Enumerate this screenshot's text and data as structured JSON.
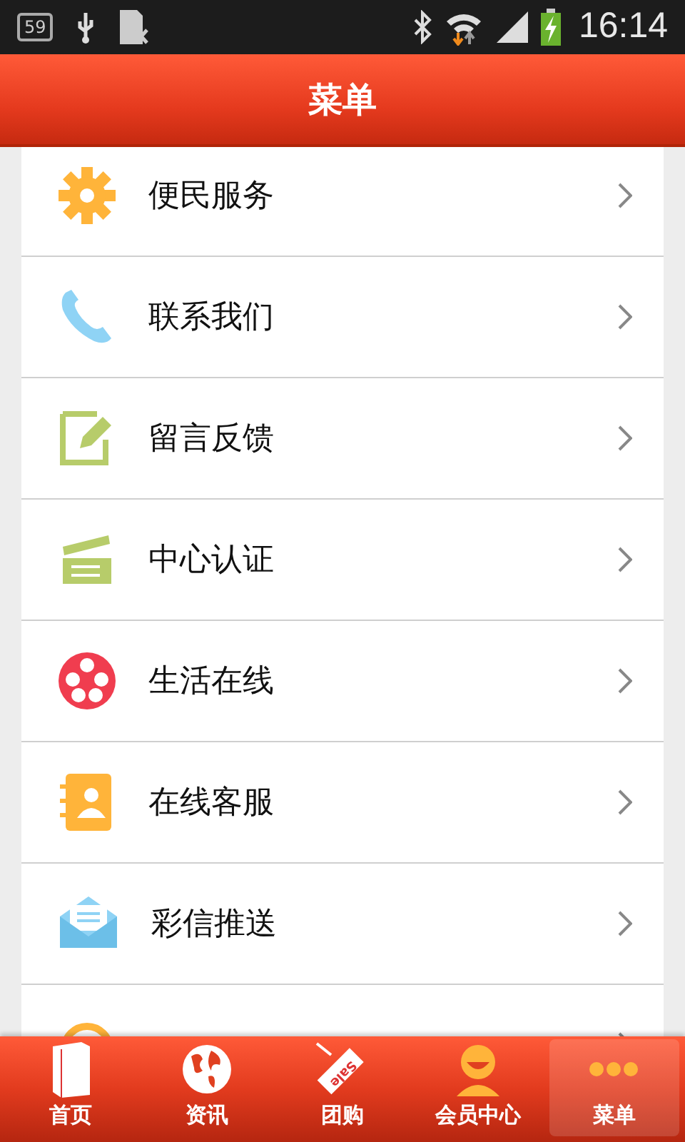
{
  "status_bar": {
    "notification_count": "59",
    "time": "16:14"
  },
  "header": {
    "title": "菜单"
  },
  "menu_items": [
    {
      "kind": "full",
      "label": "便民服务"
    },
    {
      "kind": "full",
      "label": "联系我们"
    },
    {
      "kind": "full",
      "label": "留言反馈"
    },
    {
      "kind": "full",
      "label": "中心认证"
    },
    {
      "kind": "full",
      "label": "生活在线"
    },
    {
      "kind": "full",
      "label": "在线客服"
    },
    {
      "kind": "full",
      "label": "彩信推送"
    },
    {
      "kind": "cut"
    }
  ],
  "tab_bar": [
    {
      "label": "首页",
      "selected": false
    },
    {
      "label": "资讯",
      "selected": false
    },
    {
      "label": "团购",
      "selected": false,
      "icon_text": "Sale"
    },
    {
      "label": "会员中心",
      "selected": false
    },
    {
      "label": "菜单",
      "selected": true
    }
  ]
}
